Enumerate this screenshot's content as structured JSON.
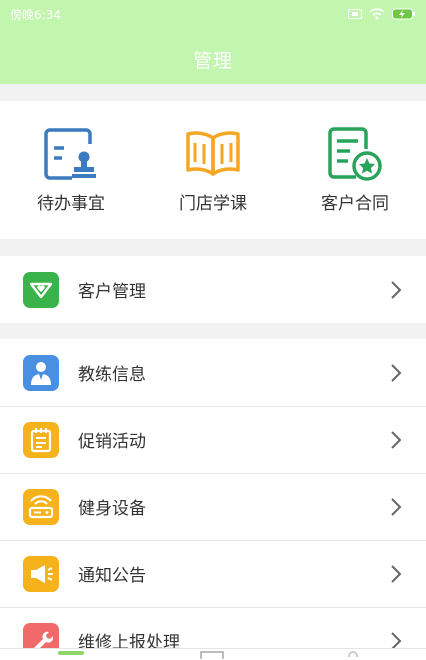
{
  "status_bar": {
    "carrier": "傍晚6:34",
    "battery_color": "#6ec842"
  },
  "header": {
    "title": "管理",
    "background": "#c2f5ae"
  },
  "quick_actions": [
    {
      "label": "待办事宜",
      "icon": "todo-stamp-icon",
      "color": "#3b7bbf"
    },
    {
      "label": "门店学课",
      "icon": "open-book-icon",
      "color": "#f5a623"
    },
    {
      "label": "客户合同",
      "icon": "contract-star-icon",
      "color": "#27a35a"
    }
  ],
  "groups": [
    {
      "items": [
        {
          "label": "客户管理",
          "icon": "customer-heart-icon",
          "color": "#3ab34a"
        }
      ]
    },
    {
      "items": [
        {
          "label": "教练信息",
          "icon": "coach-icon",
          "color": "#4a90e2"
        },
        {
          "label": "促销活动",
          "icon": "promotion-icon",
          "color": "#f5b21b"
        },
        {
          "label": "健身设备",
          "icon": "equipment-icon",
          "color": "#f5b21b"
        },
        {
          "label": "通知公告",
          "icon": "announcement-icon",
          "color": "#f5b21b"
        },
        {
          "label": "维修上报处理",
          "icon": "repair-icon",
          "color": "#f06a6a"
        }
      ]
    }
  ]
}
